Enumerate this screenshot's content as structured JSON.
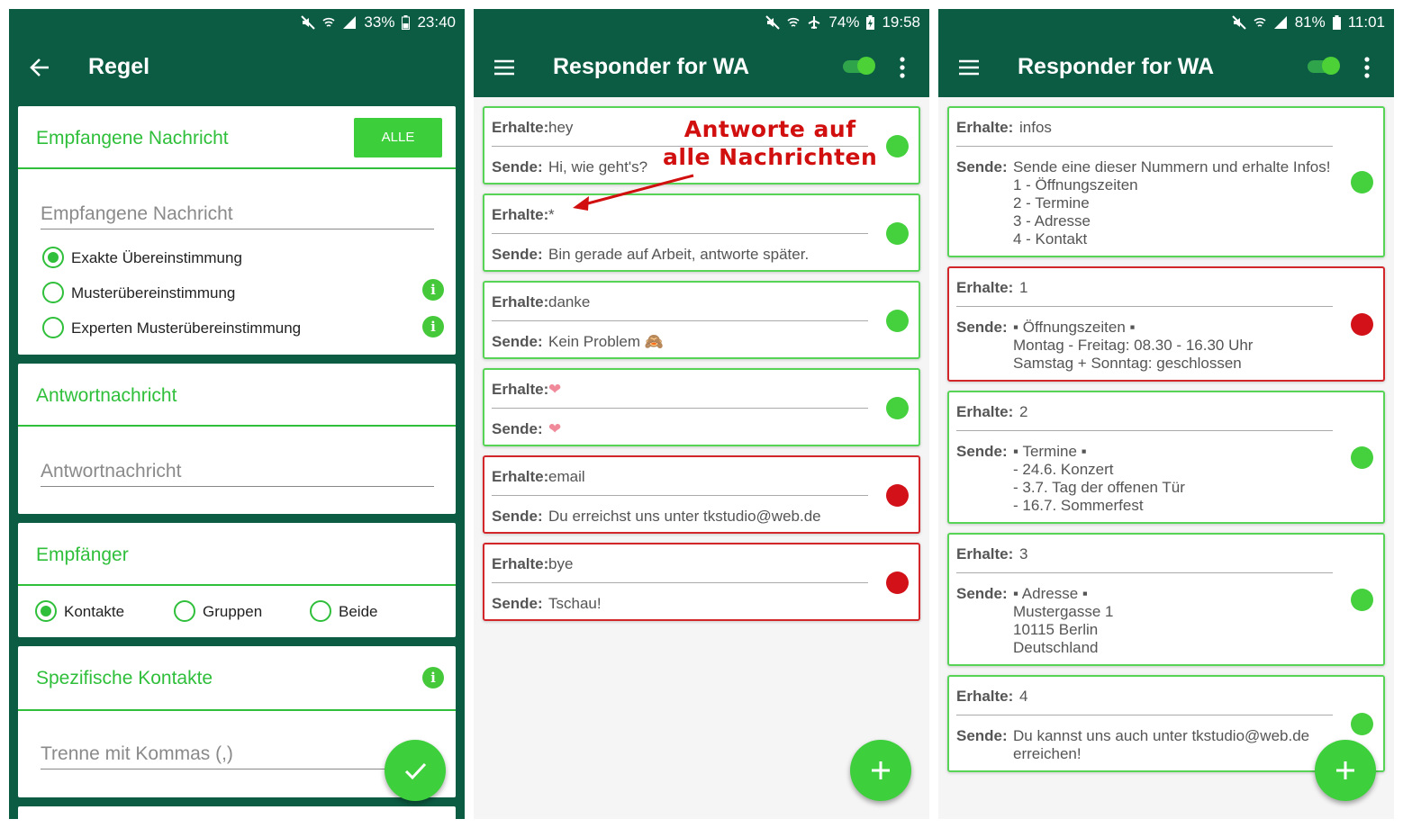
{
  "panel1": {
    "status": {
      "battery": "33%",
      "time": "23:40"
    },
    "appbar": {
      "title": "Regel",
      "back_icon": "arrow-left-icon"
    },
    "received_card": {
      "title": "Empfangene Nachricht",
      "all_button": "ALLE",
      "input_placeholder": "Empfangene Nachricht",
      "options": [
        "Exakte Übereinstimmung",
        "Musterübereinstimmung",
        "Experten Musterübereinstimmung"
      ],
      "selected": 0
    },
    "reply_card": {
      "title": "Antwortnachricht",
      "input_placeholder": "Antwortnachricht"
    },
    "recipient_card": {
      "title": "Empfänger",
      "options": [
        "Kontakte",
        "Gruppen",
        "Beide"
      ],
      "selected": 0
    },
    "contacts_card": {
      "title": "Spezifische Kontakte",
      "input_placeholder": "Trenne mit Kommas (,)"
    },
    "fab_icon": "check-icon"
  },
  "panel2": {
    "status": {
      "battery": "74%",
      "time": "19:58"
    },
    "appbar": {
      "title": "Responder for WA",
      "menu_icon": "hamburger-menu-icon",
      "more_icon": "more-vert-icon"
    },
    "labels": {
      "receive": "Erhalte:",
      "send": "Sende:"
    },
    "annotation": {
      "line1": "Antworte auf",
      "line2": "alle Nachrichten"
    },
    "rules": [
      {
        "receive": "hey",
        "send": "Hi, wie geht's?",
        "active": true
      },
      {
        "receive": "*",
        "send": "Bin gerade auf Arbeit, antworte später.",
        "active": true
      },
      {
        "receive": "danke",
        "send": "Kein Problem 🙈",
        "active": true
      },
      {
        "receive": "❤",
        "send": "❤",
        "active": true
      },
      {
        "receive": "email",
        "send": "Du erreichst uns unter tkstudio@web.de",
        "active": false
      },
      {
        "receive": "bye",
        "send": "Tschau!",
        "active": false
      }
    ],
    "fab_icon": "plus-icon"
  },
  "panel3": {
    "status": {
      "battery": "81%",
      "time": "11:01"
    },
    "appbar": {
      "title": "Responder for WA"
    },
    "rules": [
      {
        "receive": "infos",
        "send": "Sende eine dieser Nummern und erhalte Infos!\n1 - Öffnungszeiten\n2 - Termine\n3 - Adresse\n4 - Kontakt",
        "active": true
      },
      {
        "receive": "1",
        "send": "▪ Öffnungszeiten ▪\nMontag - Freitag: 08.30 - 16.30 Uhr\nSamstag + Sonntag: geschlossen",
        "active": false
      },
      {
        "receive": "2",
        "send": "▪ Termine ▪\n- 24.6. Konzert\n- 3.7. Tag der offenen Tür\n- 16.7. Sommerfest",
        "active": true
      },
      {
        "receive": "3",
        "send": "▪ Adresse ▪\nMustergasse 1\n10115 Berlin\nDeutschland",
        "active": true
      },
      {
        "receive": "4",
        "send": "Du kannst uns auch unter tkstudio@web.de\nerreichen!",
        "active": true
      }
    ],
    "fab_icon": "plus-icon"
  },
  "colors": {
    "primary": "#0c5c44",
    "accent": "#2fbf3a",
    "active": "#45d03e",
    "inactive": "#d21118",
    "annotation": "#d10f0f"
  }
}
